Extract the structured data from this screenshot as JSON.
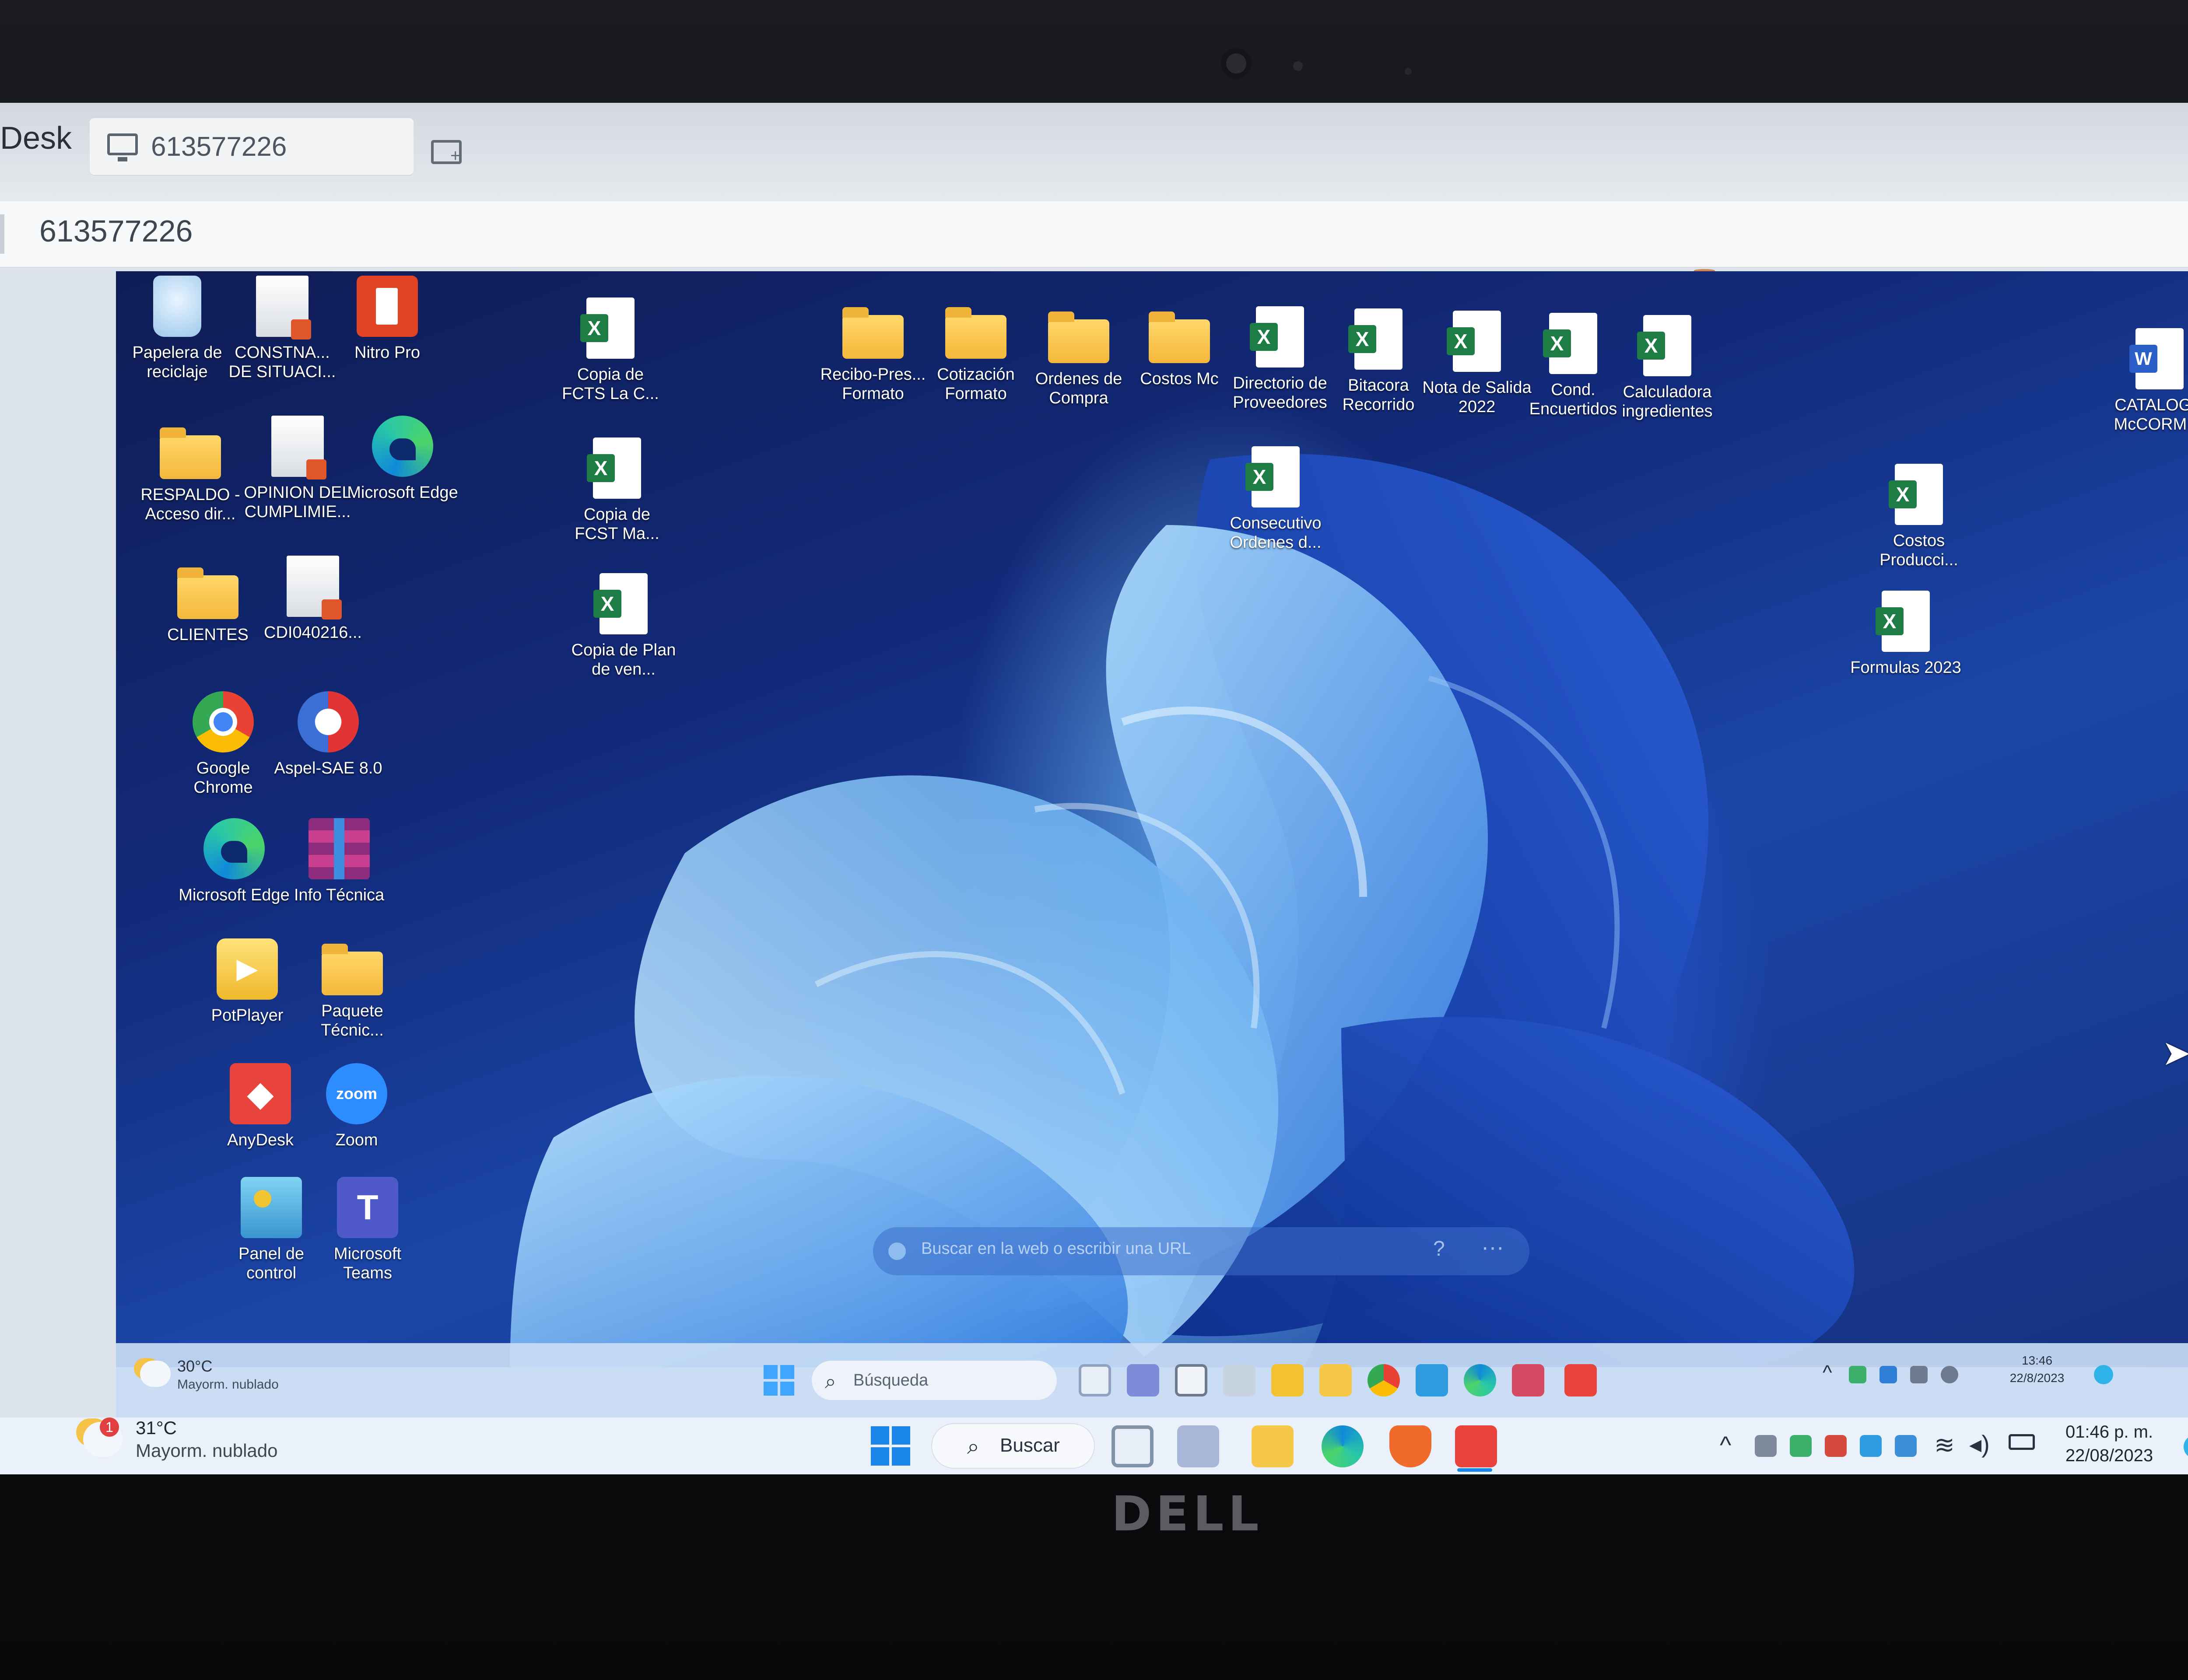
{
  "anydesk": {
    "app_name": "Desk",
    "session_tab": "613577226",
    "address": "613577226"
  },
  "desktop_icons": {
    "recycle": "Papelera de reciclaje",
    "constna": "CONSTNA... DE SITUACI...",
    "nitro": "Nitro Pro",
    "respaldo": "RESPALDO - Acceso dir...",
    "opinion": "OPINION DEL CUMPLIMIE...",
    "edge1": "Microsoft Edge",
    "clientes": "CLIENTES",
    "cdi": "CDI040216...",
    "chrome": "Google Chrome",
    "aspel": "Aspel-SAE 8.0",
    "edge2": "Microsoft Edge",
    "info": "Info Técnica",
    "potplayer": "PotPlayer",
    "paquete": "Paquete Técnic...",
    "anydesk": "AnyDesk",
    "zoom": "Zoom",
    "panel": "Panel de control",
    "teams": "Microsoft Teams",
    "copia_fcts": "Copia de FCTS La C...",
    "copia_fcst": "Copia de FCST Ma...",
    "copia_plan": "Copia de Plan de ven...",
    "recibo": "Recibo-Pres... Formato",
    "cotizacion": "Cotización Formato",
    "ordenes": "Ordenes de Compra",
    "costos_mc": "Costos Mc",
    "directorio": "Directorio de Proveedores",
    "bitacora": "Bitacora Recorrido",
    "nota": "Nota de Salida 2022",
    "cond": "Cond. Encuertidos",
    "calculadora": "Calculadora ingredientes",
    "consecutivo": "Consecutivo Ordenes d...",
    "catalogo": "CATALOGO McCORMI...",
    "costos_prod": "Costos Producci...",
    "formulas": "Formulas 2023"
  },
  "remote_search": {
    "placeholder": "Buscar en la web o escribir una URL"
  },
  "remote_taskbar": {
    "temp": "30°C",
    "condition": "Mayorm. nublado",
    "search_label": "Búsqueda",
    "time": "13:46",
    "date": "22/8/2023"
  },
  "local_taskbar": {
    "badge": "1",
    "temp": "31°C",
    "condition": "Mayorm. nublado",
    "search_label": "Buscar",
    "time": "01:46 p. m.",
    "date": "22/08/2023"
  },
  "brand": "DELL",
  "colors": {
    "accent_red": "#e0312e",
    "windows_blue": "#1a86e8",
    "excel_green": "#1d7d45"
  }
}
